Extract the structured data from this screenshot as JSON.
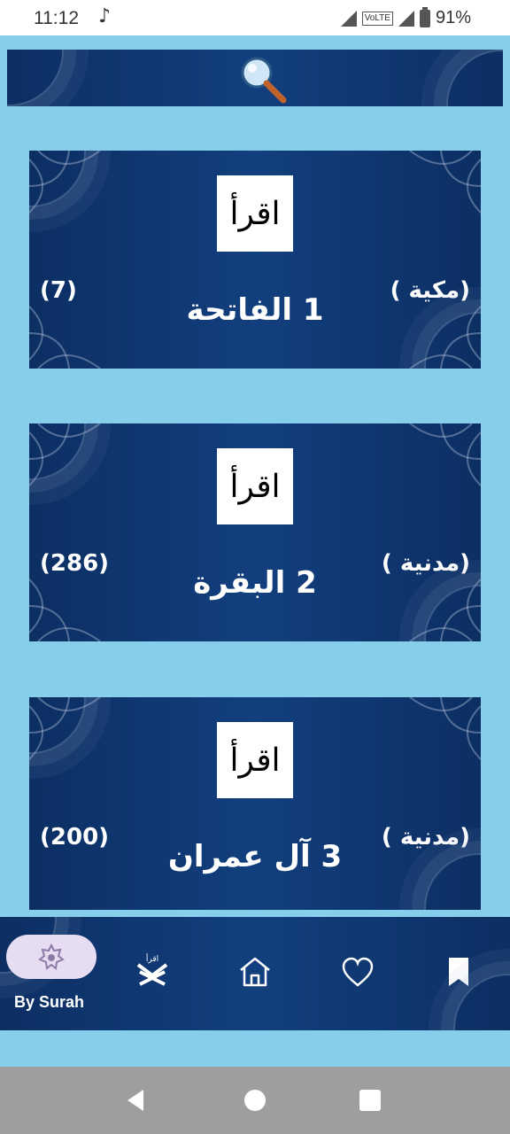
{
  "status_bar": {
    "time": "11:12",
    "network": "VoLTE",
    "battery": "91%"
  },
  "search": {
    "icon": "search-icon"
  },
  "surahs": [
    {
      "number_name": "1 الفاتحة",
      "type": "(مكية )",
      "ayah_count": "(7)",
      "badge": "اقرأ"
    },
    {
      "number_name": "2 البقرة",
      "type": "(مدنية )",
      "ayah_count": "(286)",
      "badge": "اقرأ"
    },
    {
      "number_name": "3 آل عمران",
      "type": "(مدنية )",
      "ayah_count": "(200)",
      "badge": "اقرأ"
    }
  ],
  "bottom_nav": {
    "active_label": "By Surah",
    "items": [
      {
        "icon": "by-surah-icon"
      },
      {
        "icon": "quran-stand-icon"
      },
      {
        "icon": "home-icon"
      },
      {
        "icon": "heart-icon"
      },
      {
        "icon": "bookmark-icon"
      }
    ]
  },
  "colors": {
    "background": "#87ceeb",
    "panel": "#0c2f63",
    "pill": "#e7ddf3"
  }
}
